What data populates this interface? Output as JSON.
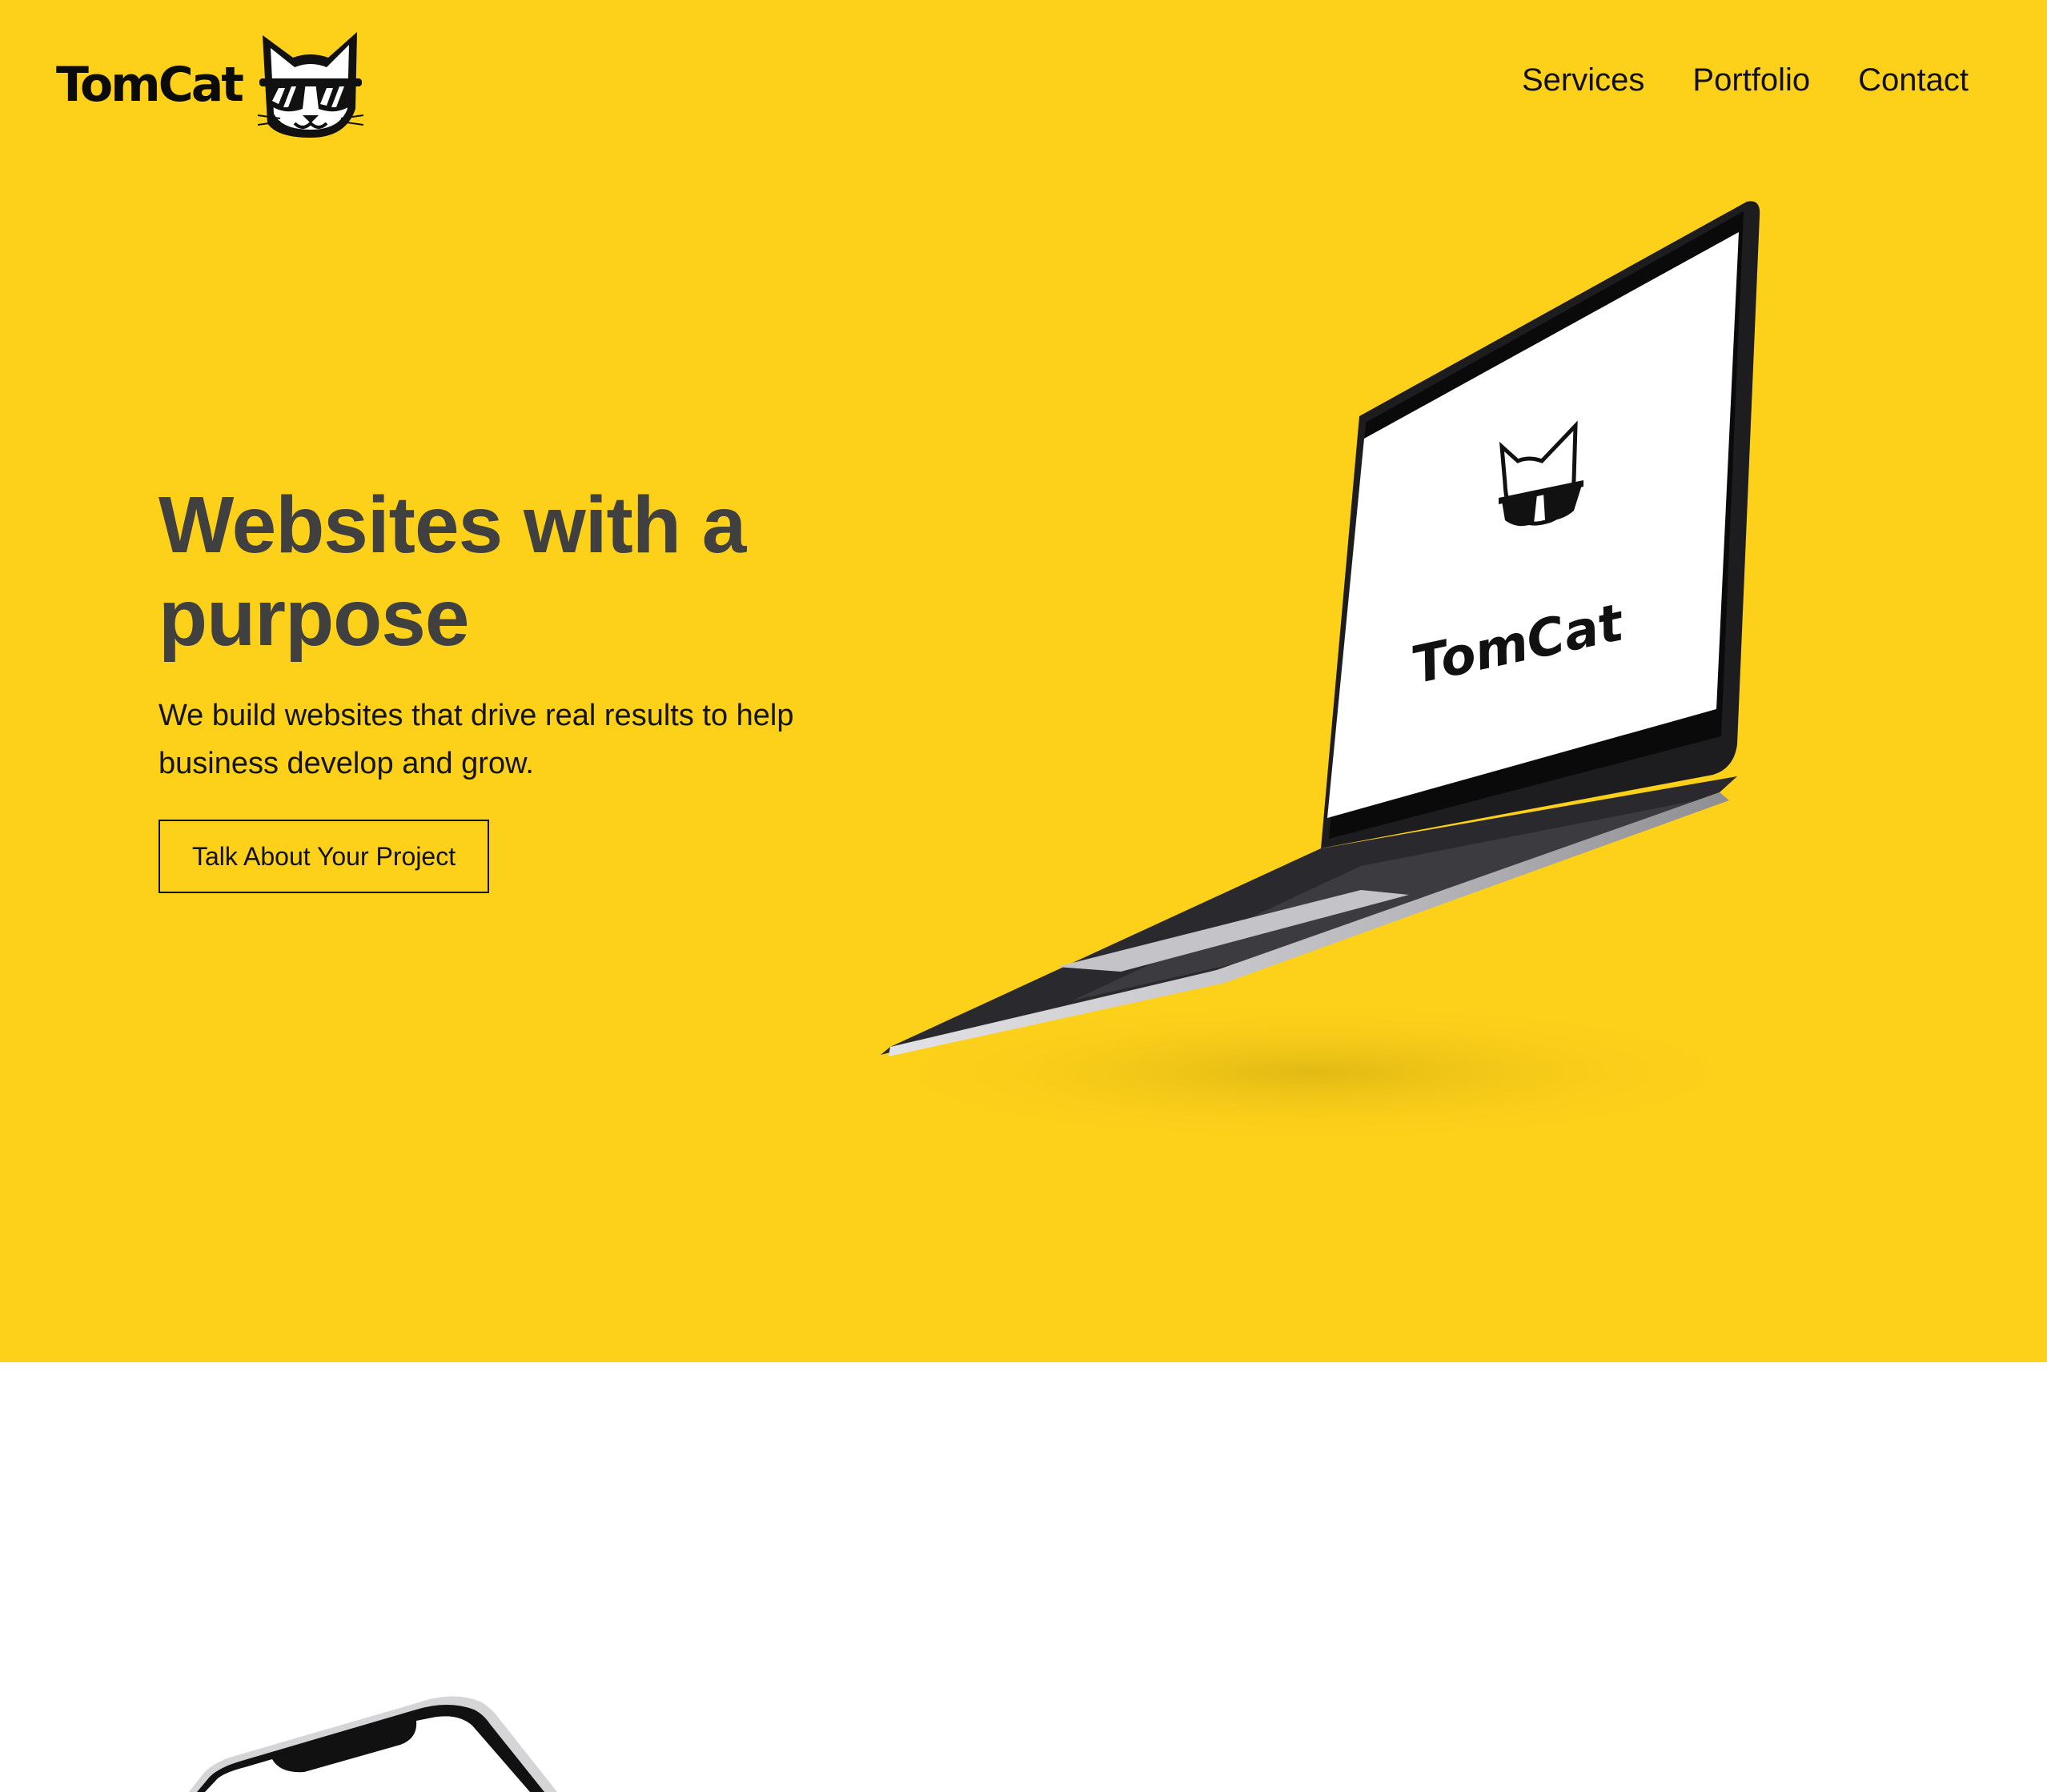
{
  "brand": {
    "name": "TomCat",
    "logo_icon": "cool-cat-sunglasses-icon"
  },
  "nav": {
    "items": [
      {
        "label": "Services"
      },
      {
        "label": "Portfolio"
      },
      {
        "label": "Contact"
      }
    ]
  },
  "hero": {
    "title": "Websites with a purpose",
    "subtitle": "We build websites that drive real results to help business develop and grow.",
    "cta_label": "Talk About Your Project",
    "background_color": "#FDD01A",
    "laptop_screen_text": "TomCat"
  },
  "colors": {
    "accent": "#FDD01A",
    "heading": "#404040",
    "text": "#141414"
  }
}
